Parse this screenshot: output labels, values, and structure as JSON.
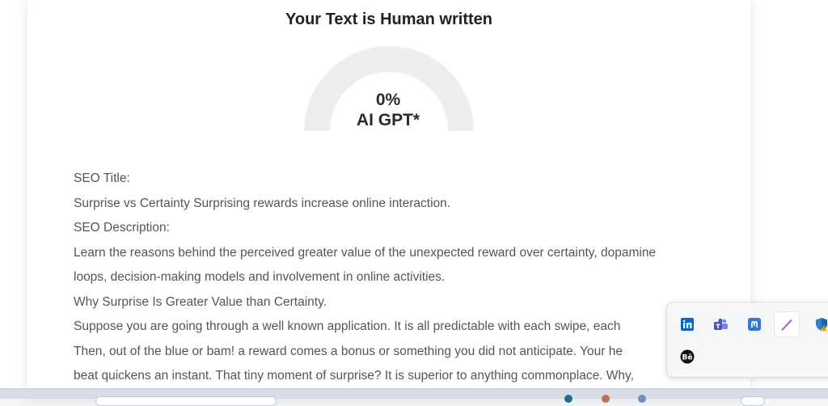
{
  "result": {
    "title": "Your Text is Human written",
    "gauge_percent": "0%",
    "gauge_label": "AI GPT*",
    "ai_fraction": 0.0
  },
  "content": {
    "lines": [
      "SEO Title:",
      "Surprise vs Certainty Surprising rewards increase online interaction.",
      "SEO Description:",
      "Learn the reasons behind the perceived greater value of the unexpected reward over certainty, dopamine",
      "loops, decision-making models and involvement in online activities.",
      "Why Surprise Is Greater Value than Certainty.",
      "Suppose you are going through a well known application. It is all predictable with each swipe, each",
      "Then, out of the blue or bam! a reward comes a bonus or something you did not anticipate. Your he",
      "beat quickens an instant. That tiny moment of surprise? It is superior to anything commonplace. Why,"
    ]
  },
  "tray": {
    "icons": [
      "linkedin-icon",
      "teams-icon",
      "mastodon-icon",
      "pen-icon",
      "shield-warning-icon",
      "behance-icon"
    ]
  },
  "colors": {
    "gauge_track": "#eeeeee",
    "accent": "#1f5d82",
    "text": "#555555",
    "title": "#222222"
  }
}
